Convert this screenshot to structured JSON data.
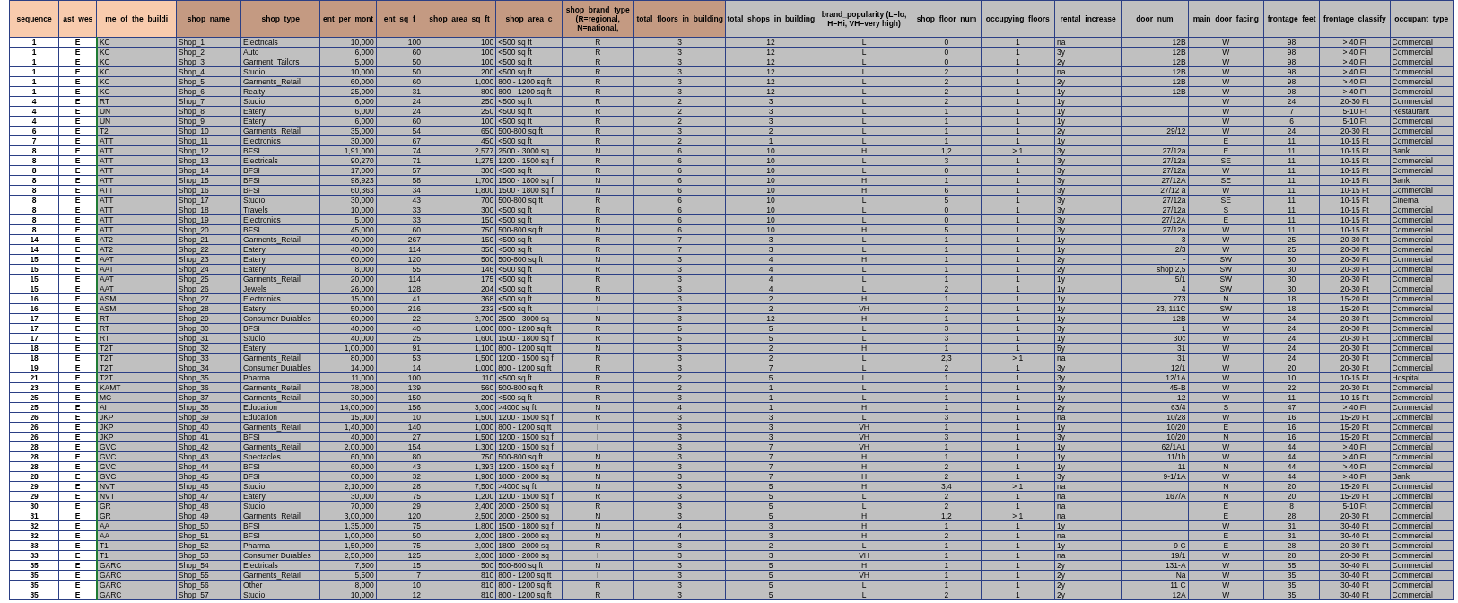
{
  "table": {
    "columns": [
      {
        "label": "sequence",
        "color": "#f8cbad"
      },
      {
        "label": "ast_wes",
        "color": "#f8cbad"
      },
      {
        "label": "me_of_the_buildi",
        "color": "#f8cbad"
      },
      {
        "label": "shop_name",
        "color": "#c49a82"
      },
      {
        "label": "shop_type",
        "color": "#c49a82"
      },
      {
        "label": "ent_per_mont",
        "color": "#c49a82"
      },
      {
        "label": "ent_sq_f",
        "color": "#c49a82"
      },
      {
        "label": "shop_area_sq_ft",
        "color": "#c49a82"
      },
      {
        "label": "shop_area_c",
        "color": "#c49a82"
      },
      {
        "label": "shop_brand_type (R=regional, N=national,",
        "color": "#c49a82"
      },
      {
        "label": "total_floors_in_building",
        "color": "#c49a82"
      },
      {
        "label": "total_shops_in_building",
        "color": "#c0c0c0"
      },
      {
        "label": "brand_popularity (L=lo, H=Hi, VH=very high)",
        "color": "#c0c0c0"
      },
      {
        "label": "shop_floor_num",
        "color": "#c0c0c0"
      },
      {
        "label": "occupying_floors",
        "color": "#c0c0c0"
      },
      {
        "label": "rental_increase",
        "color": "#c0c0c0"
      },
      {
        "label": "door_num",
        "color": "#c0c0c0"
      },
      {
        "label": "main_door_facing",
        "color": "#c0c0c0"
      },
      {
        "label": "frontage_feet",
        "color": "#c0c0c0"
      },
      {
        "label": "frontage_classify",
        "color": "#c0c0c0"
      },
      {
        "label": "occupant_type",
        "color": "#c0c0c0"
      }
    ],
    "rows": [
      [
        "1",
        "E",
        "KC",
        "Shop_1",
        "Electricals",
        "10,000",
        "100",
        "100",
        "<500 sq ft",
        "R",
        "3",
        "12",
        "L",
        "0",
        "1",
        "na",
        "12B",
        "W",
        "98",
        "> 40 Ft",
        "Commercial"
      ],
      [
        "1",
        "E",
        "KC",
        "Shop_2",
        "Auto",
        "6,000",
        "60",
        "100",
        "<500 sq ft",
        "R",
        "3",
        "12",
        "L",
        "0",
        "1",
        "3y",
        "12B",
        "W",
        "98",
        "> 40 Ft",
        "Commercial"
      ],
      [
        "1",
        "E",
        "KC",
        "Shop_3",
        "Garment_Tailors",
        "5,000",
        "50",
        "100",
        "<500 sq ft",
        "R",
        "3",
        "12",
        "L",
        "0",
        "1",
        "2y",
        "12B",
        "W",
        "98",
        "> 40 Ft",
        "Commercial"
      ],
      [
        "1",
        "E",
        "KC",
        "Shop_4",
        "Studio",
        "10,000",
        "50",
        "200",
        "<500 sq ft",
        "R",
        "3",
        "12",
        "L",
        "2",
        "1",
        "na",
        "12B",
        "W",
        "98",
        "> 40 Ft",
        "Commercial"
      ],
      [
        "1",
        "E",
        "KC",
        "Shop_5",
        "Garments_Retail",
        "60,000",
        "60",
        "1,000",
        "800 - 1200 sq ft",
        "R",
        "3",
        "12",
        "L",
        "2",
        "1",
        "2y",
        "12B",
        "W",
        "98",
        "> 40 Ft",
        "Commercial"
      ],
      [
        "1",
        "E",
        "KC",
        "Shop_6",
        "Realty",
        "25,000",
        "31",
        "800",
        "800 - 1200 sq ft",
        "R",
        "3",
        "12",
        "L",
        "2",
        "1",
        "1y",
        "12B",
        "W",
        "98",
        "> 40 Ft",
        "Commercial"
      ],
      [
        "4",
        "E",
        "RT",
        "Shop_7",
        "Studio",
        "6,000",
        "24",
        "250",
        "<500 sq ft",
        "R",
        "2",
        "3",
        "L",
        "2",
        "1",
        "1y",
        null,
        "W",
        "24",
        "20-30 Ft",
        "Commercial"
      ],
      [
        "4",
        "E",
        "UN",
        "Shop_8",
        "Eatery",
        "6,000",
        "24",
        "250",
        "<500 sq ft",
        "R",
        "2",
        "3",
        "L",
        "1",
        "1",
        "1y",
        null,
        "W",
        "7",
        "5-10 Ft",
        "Restaurant"
      ],
      [
        "4",
        "E",
        "UN",
        "Shop_9",
        "Eatery",
        "6,000",
        "60",
        "100",
        "<500 sq ft",
        "R",
        "2",
        "3",
        "L",
        "1",
        "1",
        "1y",
        null,
        "W",
        "6",
        "5-10 Ft",
        "Commercial"
      ],
      [
        "6",
        "E",
        "T2",
        "Shop_10",
        "Garments_Retail",
        "35,000",
        "54",
        "650",
        "500-800 sq ft",
        "R",
        "3",
        "2",
        "L",
        "1",
        "1",
        "2y",
        "29/12",
        "W",
        "24",
        "20-30 Ft",
        "Commercial"
      ],
      [
        "7",
        "E",
        "ATT",
        "Shop_11",
        "Electronics",
        "30,000",
        "67",
        "450",
        "<500 sq ft",
        "R",
        "2",
        "1",
        "L",
        "1",
        "1",
        "1y",
        null,
        "E",
        "11",
        "10-15 Ft",
        "Commercial"
      ],
      [
        "8",
        "E",
        "ATT",
        "Shop_12",
        "BFSI",
        "1,91,000",
        "74",
        "2,577",
        "2500 - 3000 sq",
        "N",
        "6",
        "10",
        "H",
        "1,2",
        "> 1",
        "3y",
        "27/12a",
        "E",
        "11",
        "10-15 Ft",
        "Bank"
      ],
      [
        "8",
        "E",
        "ATT",
        "Shop_13",
        "Electricals",
        "90,270",
        "71",
        "1,275",
        "1200 - 1500 sq f",
        "R",
        "6",
        "10",
        "L",
        "3",
        "1",
        "3y",
        "27/12a",
        "SE",
        "11",
        "10-15 Ft",
        "Commercial"
      ],
      [
        "8",
        "E",
        "ATT",
        "Shop_14",
        "BFSI",
        "17,000",
        "57",
        "300",
        "<500 sq ft",
        "R",
        "6",
        "10",
        "L",
        "0",
        "1",
        "3y",
        "27/12a",
        "W",
        "11",
        "10-15 Ft",
        "Commercial"
      ],
      [
        "8",
        "E",
        "ATT",
        "Shop_15",
        "BFSI",
        "98,923",
        "58",
        "1,700",
        "1500 - 1800 sq f",
        "N",
        "6",
        "10",
        "H",
        "1",
        "1",
        "3y",
        "27/12A",
        "SE",
        "11",
        "10-15 Ft",
        "Bank"
      ],
      [
        "8",
        "E",
        "ATT",
        "Shop_16",
        "BFSI",
        "60,363",
        "34",
        "1,800",
        "1500 - 1800 sq f",
        "N",
        "6",
        "10",
        "H",
        "6",
        "1",
        "3y",
        "27/12 a",
        "W",
        "11",
        "10-15 Ft",
        "Commercial"
      ],
      [
        "8",
        "E",
        "ATT",
        "Shop_17",
        "Studio",
        "30,000",
        "43",
        "700",
        "500-800 sq ft",
        "R",
        "6",
        "10",
        "L",
        "5",
        "1",
        "3y",
        "27/12a",
        "SE",
        "11",
        "10-15 Ft",
        "Cinema"
      ],
      [
        "8",
        "E",
        "ATT",
        "Shop_18",
        "Travels",
        "10,000",
        "33",
        "300",
        "<500 sq ft",
        "R",
        "6",
        "10",
        "L",
        "0",
        "1",
        "3y",
        "27/12a",
        "S",
        "11",
        "10-15 Ft",
        "Commercial"
      ],
      [
        "8",
        "E",
        "ATT",
        "Shop_19",
        "Electronics",
        "5,000",
        "33",
        "150",
        "<500 sq ft",
        "R",
        "6",
        "10",
        "L",
        "0",
        "1",
        "3y",
        "27/12A",
        "E",
        "11",
        "10-15 Ft",
        "Commercial"
      ],
      [
        "8",
        "E",
        "ATT",
        "Shop_20",
        "BFSI",
        "45,000",
        "60",
        "750",
        "500-800 sq ft",
        "N",
        "6",
        "10",
        "H",
        "5",
        "1",
        "3y",
        "27/12a",
        "W",
        "11",
        "10-15 Ft",
        "Commercial"
      ],
      [
        "14",
        "E",
        "AT2",
        "Shop_21",
        "Garments_Retail",
        "40,000",
        "267",
        "150",
        "<500 sq ft",
        "R",
        "7",
        "3",
        "L",
        "1",
        "1",
        "1y",
        "3",
        "W",
        "25",
        "20-30 Ft",
        "Commercial"
      ],
      [
        "14",
        "E",
        "AT2",
        "Shop_22",
        "Eatery",
        "40,000",
        "114",
        "350",
        "<500 sq ft",
        "R",
        "7",
        "3",
        "L",
        "1",
        "1",
        "1y",
        "2/3",
        "W",
        "25",
        "20-30 Ft",
        "Commercial"
      ],
      [
        "15",
        "E",
        "AAT",
        "Shop_23",
        "Eatery",
        "60,000",
        "120",
        "500",
        "500-800 sq ft",
        "N",
        "3",
        "4",
        "H",
        "1",
        "1",
        "2y",
        "-",
        "SW",
        "30",
        "20-30 Ft",
        "Commercial"
      ],
      [
        "15",
        "E",
        "AAT",
        "Shop_24",
        "Eatery",
        "8,000",
        "55",
        "146",
        "<500 sq ft",
        "R",
        "3",
        "4",
        "L",
        "1",
        "1",
        "2y",
        "shop 2,5",
        "SW",
        "30",
        "20-30 Ft",
        "Commercial"
      ],
      [
        "15",
        "E",
        "AAT",
        "Shop_25",
        "Garments_Retail",
        "20,000",
        "114",
        "175",
        "<500 sq ft",
        "R",
        "3",
        "4",
        "L",
        "1",
        "1",
        "1y",
        "5/1",
        "SW",
        "30",
        "20-30 Ft",
        "Commercial"
      ],
      [
        "15",
        "E",
        "AAT",
        "Shop_26",
        "Jewels",
        "26,000",
        "128",
        "204",
        "<500 sq ft",
        "R",
        "3",
        "4",
        "L",
        "2",
        "1",
        "1y",
        "4",
        "SW",
        "30",
        "20-30 Ft",
        "Commercial"
      ],
      [
        "16",
        "E",
        "ASM",
        "Shop_27",
        "Electronics",
        "15,000",
        "41",
        "368",
        "<500 sq ft",
        "N",
        "3",
        "2",
        "H",
        "1",
        "1",
        "1y",
        "273",
        "N",
        "18",
        "15-20 Ft",
        "Commercial"
      ],
      [
        "16",
        "E",
        "ASM",
        "Shop_28",
        "Eatery",
        "50,000",
        "216",
        "232",
        "<500 sq ft",
        "I",
        "3",
        "2",
        "VH",
        "2",
        "1",
        "1y",
        "23, 111C",
        "SW",
        "18",
        "15-20 Ft",
        "Commercial"
      ],
      [
        "17",
        "E",
        "RT",
        "Shop_29",
        "Consumer Durables",
        "60,000",
        "22",
        "2,700",
        "2500 - 3000 sq",
        "N",
        "3",
        "12",
        "H",
        "1",
        "1",
        "1y",
        "12B",
        "W",
        "24",
        "20-30 Ft",
        "Commercial"
      ],
      [
        "17",
        "E",
        "RT",
        "Shop_30",
        "BFSI",
        "40,000",
        "40",
        "1,000",
        "800 - 1200 sq ft",
        "R",
        "5",
        "5",
        "L",
        "3",
        "1",
        "3y",
        "1",
        "W",
        "24",
        "20-30 Ft",
        "Commercial"
      ],
      [
        "17",
        "E",
        "RT",
        "Shop_31",
        "Studio",
        "40,000",
        "25",
        "1,600",
        "1500 - 1800 sq f",
        "R",
        "5",
        "5",
        "L",
        "3",
        "1",
        "1y",
        "30c",
        "W",
        "24",
        "20-30 Ft",
        "Commercial"
      ],
      [
        "18",
        "E",
        "T2T",
        "Shop_32",
        "Eatery",
        "1,00,000",
        "91",
        "1,100",
        "800 - 1200 sq ft",
        "N",
        "3",
        "2",
        "H",
        "1",
        "1",
        "5y",
        "31",
        "W",
        "24",
        "20-30 Ft",
        "Commercial"
      ],
      [
        "18",
        "E",
        "T2T",
        "Shop_33",
        "Garments_Retail",
        "80,000",
        "53",
        "1,500",
        "1200 - 1500 sq f",
        "R",
        "3",
        "2",
        "L",
        "2,3",
        "> 1",
        "na",
        "31",
        "W",
        "24",
        "20-30 Ft",
        "Commercial"
      ],
      [
        "19",
        "E",
        "T2T",
        "Shop_34",
        "Consumer Durables",
        "14,000",
        "14",
        "1,000",
        "800 - 1200 sq ft",
        "R",
        "3",
        "7",
        "L",
        "2",
        "1",
        "3y",
        "12/1",
        "W",
        "20",
        "20-30 Ft",
        "Commercial"
      ],
      [
        "21",
        "E",
        "T2T",
        "Shop_35",
        "Pharma",
        "11,000",
        "100",
        "110",
        "<500 sq ft",
        "R",
        "2",
        "5",
        "L",
        "1",
        "1",
        "3y",
        "12/1A",
        "W",
        "10",
        "10-15 Ft",
        "Hospital"
      ],
      [
        "23",
        "E",
        "KAMT",
        "Shop_36",
        "Garments_Retail",
        "78,000",
        "139",
        "560",
        "500-800 sq ft",
        "R",
        "2",
        "1",
        "L",
        "1",
        "1",
        "3y",
        "45-B",
        "W",
        "22",
        "20-30 Ft",
        "Commercial"
      ],
      [
        "25",
        "E",
        "MC",
        "Shop_37",
        "Garments_Retail",
        "30,000",
        "150",
        "200",
        "<500 sq ft",
        "R",
        "3",
        "1",
        "L",
        "1",
        "1",
        "1y",
        "12",
        "W",
        "11",
        "10-15 Ft",
        "Commercial"
      ],
      [
        "25",
        "E",
        "AI",
        "Shop_38",
        "Education",
        "14,00,000",
        "156",
        "3,000",
        ">4000 sq ft",
        "N",
        "4",
        "1",
        "H",
        "1",
        "1",
        "2y",
        "63/4",
        "S",
        "47",
        "> 40 Ft",
        "Commercial"
      ],
      [
        "26",
        "E",
        "JKP",
        "Shop_39",
        "Education",
        "15,000",
        "10",
        "1,500",
        "1200 - 1500 sq f",
        "R",
        "3",
        "3",
        "L",
        "3",
        "1",
        "na",
        "10/28",
        "W",
        "16",
        "15-20 Ft",
        "Commercial"
      ],
      [
        "26",
        "E",
        "JKP",
        "Shop_40",
        "Garments_Retail",
        "1,40,000",
        "140",
        "1,000",
        "800 - 1200 sq ft",
        "I",
        "3",
        "3",
        "VH",
        "1",
        "1",
        "1y",
        "10/20",
        "E",
        "16",
        "15-20 Ft",
        "Commercial"
      ],
      [
        "26",
        "E",
        "JKP",
        "Shop_41",
        "BFSI",
        "40,000",
        "27",
        "1,500",
        "1200 - 1500 sq f",
        "I",
        "3",
        "3",
        "VH",
        "3",
        "1",
        "3y",
        "10/20",
        "N",
        "16",
        "15-20 Ft",
        "Commercial"
      ],
      [
        "28",
        "E",
        "GVC",
        "Shop_42",
        "Garments_Retail",
        "2,00,000",
        "154",
        "1,300",
        "1200 - 1500 sq f",
        "I",
        "3",
        "7",
        "VH",
        "1",
        "1",
        "1y",
        "62/1A1",
        "W",
        "44",
        "> 40 Ft",
        "Commercial"
      ],
      [
        "28",
        "E",
        "GVC",
        "Shop_43",
        "Spectacles",
        "60,000",
        "80",
        "750",
        "500-800 sq ft",
        "N",
        "3",
        "7",
        "H",
        "1",
        "1",
        "1y",
        "11/1b",
        "W",
        "44",
        "> 40 Ft",
        "Commercial"
      ],
      [
        "28",
        "E",
        "GVC",
        "Shop_44",
        "BFSI",
        "60,000",
        "43",
        "1,393",
        "1200 - 1500 sq f",
        "N",
        "3",
        "7",
        "H",
        "2",
        "1",
        "1y",
        "11",
        "N",
        "44",
        "> 40 Ft",
        "Commercial"
      ],
      [
        "28",
        "E",
        "GVC",
        "Shop_45",
        "BFSI",
        "60,000",
        "32",
        "1,900",
        "1800 - 2000 sq",
        "N",
        "3",
        "7",
        "H",
        "2",
        "1",
        "3y",
        "9-1/1A",
        "W",
        "44",
        "> 40 Ft",
        "Bank"
      ],
      [
        "29",
        "E",
        "NVT",
        "Shop_46",
        "Studio",
        "2,10,000",
        "28",
        "7,500",
        ">4000 sq ft",
        "N",
        "3",
        "5",
        "H",
        "3,4",
        "> 1",
        "na",
        null,
        "N",
        "20",
        "15-20 Ft",
        "Commercial"
      ],
      [
        "29",
        "E",
        "NVT",
        "Shop_47",
        "Eatery",
        "30,000",
        "75",
        "1,200",
        "1200 - 1500 sq f",
        "R",
        "3",
        "5",
        "L",
        "2",
        "1",
        "na",
        "167/A",
        "N",
        "20",
        "15-20 Ft",
        "Commercial"
      ],
      [
        "30",
        "E",
        "GR",
        "Shop_48",
        "Studio",
        "70,000",
        "29",
        "2,400",
        "2000 - 2500 sq",
        "R",
        "3",
        "5",
        "L",
        "2",
        "1",
        "na",
        null,
        "E",
        "8",
        "5-10 Ft",
        "Commercial"
      ],
      [
        "31",
        "E",
        "GR",
        "Shop_49",
        "Garments_Retail",
        "3,00,000",
        "120",
        "2,500",
        "2000 - 2500 sq",
        "N",
        "3",
        "5",
        "H",
        "1,2",
        "> 1",
        "na",
        null,
        "E",
        "28",
        "20-30 Ft",
        "Commercial"
      ],
      [
        "32",
        "E",
        "AA",
        "Shop_50",
        "BFSI",
        "1,35,000",
        "75",
        "1,800",
        "1500 - 1800 sq f",
        "N",
        "4",
        "3",
        "H",
        "1",
        "1",
        "1y",
        null,
        "W",
        "31",
        "30-40 Ft",
        "Commercial"
      ],
      [
        "32",
        "E",
        "AA",
        "Shop_51",
        "BFSI",
        "1,00,000",
        "50",
        "2,000",
        "1800 - 2000 sq",
        "N",
        "4",
        "3",
        "H",
        "2",
        "1",
        "na",
        null,
        "E",
        "31",
        "30-40 Ft",
        "Commercial"
      ],
      [
        "33",
        "E",
        "T1",
        "Shop_52",
        "Pharma",
        "1,50,000",
        "75",
        "2,000",
        "1800 - 2000 sq",
        "R",
        "3",
        "2",
        "L",
        "1",
        "1",
        "1y",
        "9 C",
        "E",
        "28",
        "20-30 Ft",
        "Commercial"
      ],
      [
        "33",
        "E",
        "T1",
        "Shop_53",
        "Consumer Durables",
        "2,50,000",
        "125",
        "2,000",
        "1800 - 2000 sq",
        "I",
        "3",
        "3",
        "VH",
        "1",
        "1",
        "na",
        "19/1",
        "W",
        "28",
        "20-30 Ft",
        "Commercial"
      ],
      [
        "35",
        "E",
        "GARC",
        "Shop_54",
        "Electricals",
        "7,500",
        "15",
        "500",
        "500-800 sq ft",
        "N",
        "3",
        "5",
        "H",
        "1",
        "1",
        "2y",
        "131-A",
        "W",
        "35",
        "30-40 Ft",
        "Commercial"
      ],
      [
        "35",
        "E",
        "GARC",
        "Shop_55",
        "Garments_Retail",
        "5,500",
        "7",
        "810",
        "800 - 1200 sq ft",
        "I",
        "3",
        "5",
        "VH",
        "1",
        "1",
        "2y",
        "Na",
        "W",
        "35",
        "30-40 Ft",
        "Commercial"
      ],
      [
        "35",
        "E",
        "GARC",
        "Shop_56",
        "Other",
        "8,000",
        "10",
        "810",
        "800 - 1200 sq ft",
        "R",
        "3",
        "5",
        "L",
        "1",
        "1",
        "2y",
        "11 C",
        "W",
        "35",
        "30-40 Ft",
        "Commercial"
      ],
      [
        "35",
        "E",
        "GARC",
        "Shop_57",
        "Studio",
        "10,000",
        "12",
        "810",
        "800 - 1200 sq ft",
        "R",
        "3",
        "5",
        "L",
        "2",
        "1",
        "2y",
        "12A",
        "W",
        "35",
        "30-40 Ft",
        "Commercial"
      ]
    ]
  }
}
